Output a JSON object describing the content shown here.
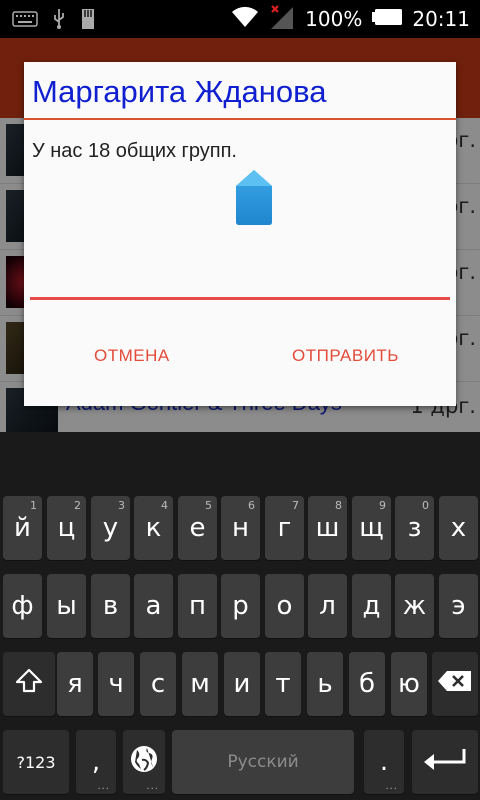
{
  "status_bar": {
    "battery_percent": "100%",
    "time": "20:11",
    "icons": [
      "keyboard-icon",
      "usb-icon",
      "sd-card-icon",
      "wifi-icon",
      "signal-no-data-icon",
      "battery-icon"
    ]
  },
  "background_list": {
    "rows": [
      {
        "meta": "рг."
      },
      {
        "meta": "рг."
      },
      {
        "meta": "рг."
      },
      {
        "meta": "рг."
      },
      {
        "title": "Adam Gontier &  Three Days",
        "meta": "1 дрг."
      }
    ]
  },
  "dialog": {
    "title": "Маргарита Жданова",
    "message": "У нас 18 общих групп.",
    "input_value": "",
    "cancel_label": "ОТМЕНА",
    "send_label": "ОТПРАВИТЬ"
  },
  "keyboard": {
    "row1": [
      {
        "label": "й",
        "hint": "1"
      },
      {
        "label": "ц",
        "hint": "2"
      },
      {
        "label": "у",
        "hint": "3"
      },
      {
        "label": "к",
        "hint": "4"
      },
      {
        "label": "е",
        "hint": "5"
      },
      {
        "label": "н",
        "hint": "6"
      },
      {
        "label": "г",
        "hint": "7"
      },
      {
        "label": "ш",
        "hint": "8"
      },
      {
        "label": "щ",
        "hint": "9"
      },
      {
        "label": "з",
        "hint": "0"
      },
      {
        "label": "х",
        "hint": ""
      }
    ],
    "row2": [
      "ф",
      "ы",
      "в",
      "а",
      "п",
      "р",
      "о",
      "л",
      "д",
      "ж",
      "э"
    ],
    "row3": [
      "я",
      "ч",
      "с",
      "м",
      "и",
      "т",
      "ь",
      "б",
      "ю"
    ],
    "symbols_label": "?123",
    "comma_label": ",",
    "space_label": "Русский",
    "period_label": ".",
    "colors": {
      "background": "#1a1a1a",
      "key": "#3d3d3d",
      "accent": "#e34b3a"
    }
  }
}
